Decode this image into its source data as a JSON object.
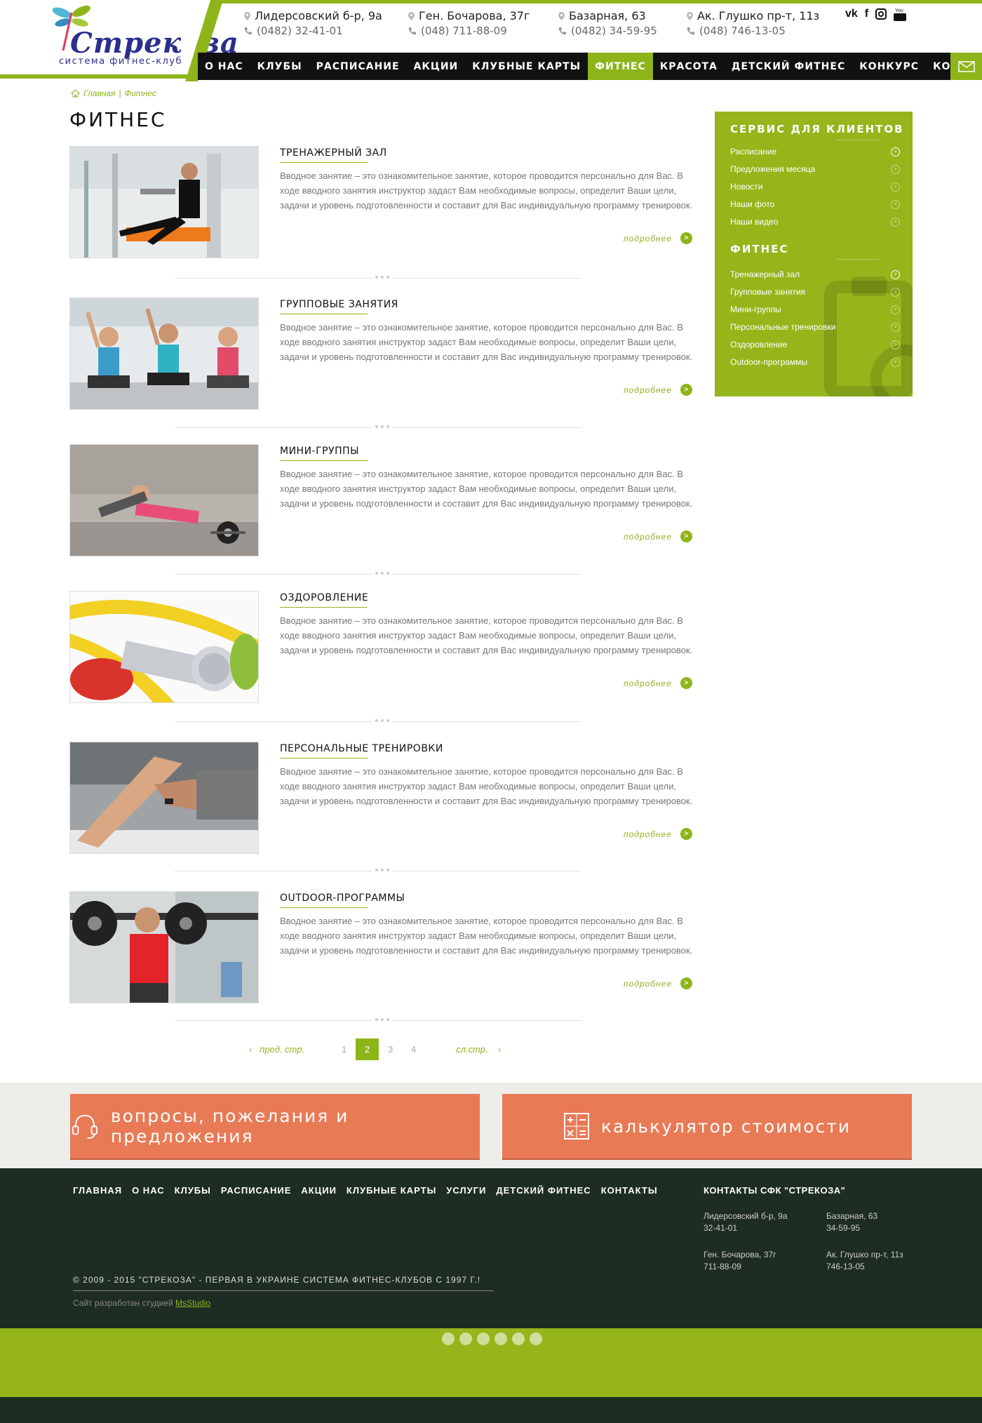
{
  "header": {
    "logo_title": "Стрекоза",
    "logo_subtitle": "система фитнес-клубов",
    "clubs": [
      {
        "address": "Лидерсовский б-р, 9а",
        "phone": "(0482) 32-41-01"
      },
      {
        "address": "Ген. Бочарова, 37г",
        "phone": "(048) 711-88-09"
      },
      {
        "address": "Базарная, 63",
        "phone": "(0482) 34-59-95"
      },
      {
        "address": "Ак. Глушко пр-т, 11з",
        "phone": "(048) 746-13-05"
      }
    ],
    "social": [
      "vk-icon",
      "facebook-icon",
      "instagram-icon",
      "youtube-icon"
    ]
  },
  "nav": {
    "items": [
      "О НАС",
      "КЛУБЫ",
      "РАСПИСАНИЕ",
      "АКЦИИ",
      "КЛУБНЫЕ КАРТЫ",
      "ФИТНЕС",
      "КРАСОТА",
      "ДЕТСКИЙ ФИТНЕС",
      "КОНКУРС",
      "КОНТАКТЫ"
    ],
    "active": "ФИТНЕС"
  },
  "breadcrumb": {
    "home": "Главная",
    "sep": "|",
    "current": "Фитнес"
  },
  "page_title": "ФИТНЕС",
  "articles": [
    {
      "title": "ТРЕНАЖЕРНЫЙ ЗАЛ",
      "text": "Вводное занятие – это ознакомительное занятие, которое проводится персонально для Вас. В ходе вводного занятия инструктор задаст Вам необходимые вопросы, определит Ваши цели, задачи и уровень подготовленности и составит для Вас индивидуальную программу тренировок.",
      "more": "подробнее"
    },
    {
      "title": "ГРУППОВЫЕ ЗАНЯТИЯ",
      "text": "Вводное занятие – это ознакомительное занятие, которое проводится персонально для Вас. В ходе вводного занятия инструктор задаст Вам необходимые вопросы, определит Ваши цели, задачи и уровень подготовленности и составит для Вас индивидуальную программу тренировок.",
      "more": "подробнее"
    },
    {
      "title": "МИНИ-ГРУППЫ",
      "text": "Вводное занятие – это ознакомительное занятие, которое проводится персонально для Вас. В ходе вводного занятия инструктор задаст Вам необходимые вопросы, определит Ваши цели, задачи и уровень подготовленности и составит для Вас индивидуальную программу тренировок.",
      "more": "подробнее"
    },
    {
      "title": "ОЗДОРОВЛЕНИЕ",
      "text": "Вводное занятие – это ознакомительное занятие, которое проводится персонально для Вас. В ходе вводного занятия инструктор задаст Вам необходимые вопросы, определит Ваши цели, задачи и уровень подготовленности и составит для Вас индивидуальную программу тренировок.",
      "more": "подробнее"
    },
    {
      "title": "ПЕРСОНАЛЬНЫЕ ТРЕНИРОВКИ",
      "text": "Вводное занятие – это ознакомительное занятие, которое проводится персонально для Вас. В ходе вводного занятия инструктор задаст Вам необходимые вопросы, определит Ваши цели, задачи и уровень подготовленности и составит для Вас индивидуальную программу тренировок.",
      "more": "подробнее"
    },
    {
      "title": "OUTDOOR-ПРОГРАММЫ",
      "text": "Вводное занятие – это ознакомительное занятие, которое проводится персонально для Вас. В ходе вводного занятия инструктор задаст Вам необходимые вопросы, определит Ваши цели, задачи и уровень подготовленности и составит для Вас индивидуальную программу тренировок.",
      "more": "подробнее"
    }
  ],
  "pagination": {
    "prev": "пред. стр.",
    "next": "сл.стр.",
    "pages": [
      "1",
      "2",
      "3",
      "4"
    ],
    "current": "2"
  },
  "sidebar": {
    "service_title": "СЕРВИС ДЛЯ КЛИЕНТОВ",
    "service_items": [
      "Расписание",
      "Предложения месяца",
      "Новости",
      "Наши фото",
      "Наши видео"
    ],
    "fitness_title": "ФИТНЕС",
    "fitness_items": [
      "Тренажерный зал",
      "Групповые занятия",
      "Мини-группы",
      "Персональные тренировки",
      "Оздоровление",
      "Outdoor-программы"
    ]
  },
  "cta": {
    "questions": "вопросы, пожелания и предложения",
    "calculator": "калькулятор стоимости"
  },
  "footer": {
    "nav": [
      "ГЛАВНАЯ",
      "О НАС",
      "КЛУБЫ",
      "РАСПИСАНИЕ",
      "АКЦИИ",
      "КЛУБНЫЕ КАРТЫ",
      "УСЛУГИ",
      "ДЕТСКИЙ ФИТНЕС",
      "КОНТАКТЫ"
    ],
    "contacts_title": "КОНТАКТЫ  СФК \"СТРЕКОЗА\"",
    "contacts": [
      {
        "address": "Лидерсовский б-р, 9а",
        "phone": "32-41-01"
      },
      {
        "address": "Базарная, 63",
        "phone": "34-59-95"
      },
      {
        "address": "Ген. Бочарова, 37г",
        "phone": "711-88-09"
      },
      {
        "address": "Ак. Глушко пр-т, 11з",
        "phone": "746-13-05"
      }
    ],
    "copyright": "© 2009 - 2015 \"СТРЕКОЗА\" - ПЕРВАЯ В УКРАИНЕ СИСТЕМА ФИТНЕС-КЛУБОВ С 1997 Г.!",
    "dev_prefix": "Сайт разработан студией",
    "dev_name": "MsStudio",
    "social": [
      "twitter-icon",
      "facebook-icon",
      "google-plus-icon",
      "pinterest-icon",
      "linkedin-icon",
      "instagram-icon"
    ]
  },
  "colors": {
    "accent": "#8db51a",
    "sidebar": "#95b51b",
    "cta": "#e87a56",
    "footer": "#1e2d22",
    "nav": "#111111"
  }
}
